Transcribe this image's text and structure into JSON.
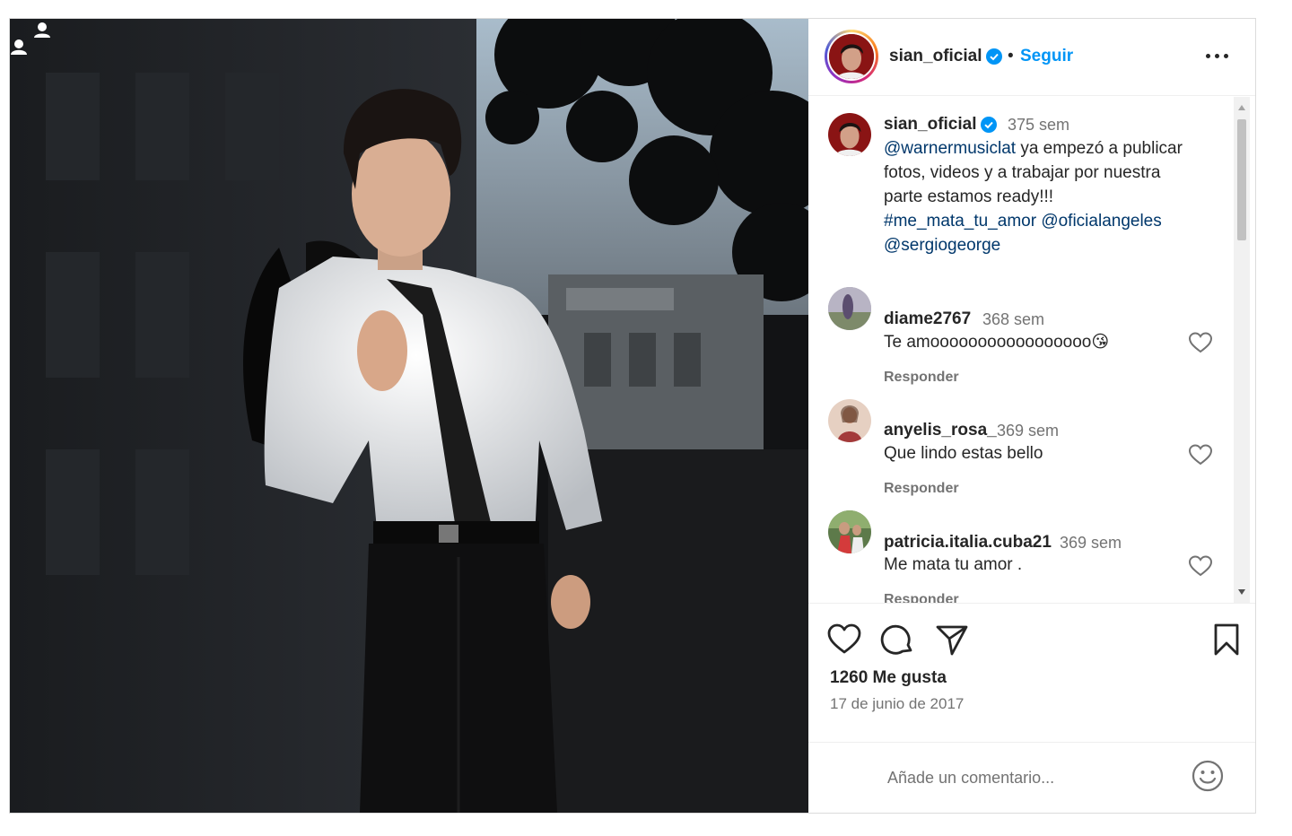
{
  "post": {
    "author": "sian_oficial",
    "follow_label": "Seguir",
    "separator": "•",
    "caption": {
      "time": "375 sem",
      "mention_1": "@warnermusiclat",
      "text_line_1": " ya empezó a publicar",
      "text_line_2": "fotos, videos y a trabajar por nuestra",
      "text_line_3": "parte estamos ready!!!",
      "hashtag": "#me_mata_tu_amor",
      "mention_2": "@oficialangeles",
      "mention_3": "@sergiogeorge"
    },
    "likes": "1260 Me gusta",
    "date": "17 de junio de 2017",
    "comment_placeholder": "Añade un comentario..."
  },
  "comments": [
    {
      "user": "diame2767",
      "time": "368 sem",
      "text": "Te amooooooooooooooooo😘",
      "reply": "Responder"
    },
    {
      "user": "anyelis_rosa_",
      "time": "369 sem",
      "text": "Que lindo estas bello",
      "reply": "Responder"
    },
    {
      "user": "patricia.italia.cuba21",
      "time": "369 sem",
      "text": "Me mata tu amor .",
      "reply": "Responder"
    }
  ],
  "icons": {
    "verified": "verified-badge-icon",
    "more": "more-options-icon",
    "like": "heart-icon",
    "comment": "comment-bubble-icon",
    "share": "paper-plane-icon",
    "save": "bookmark-icon",
    "emoji": "smiley-icon",
    "tags": "tagged-users-icon"
  },
  "colors": {
    "accent": "#0095f6",
    "link": "#00376b",
    "text": "#262626",
    "muted": "#737373"
  }
}
